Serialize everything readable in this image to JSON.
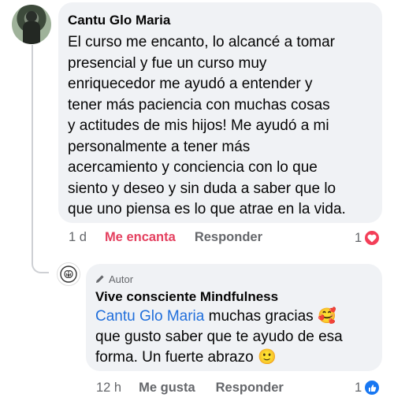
{
  "comment": {
    "author": "Cantu Glo Maria",
    "text": "El curso me encanto, lo alcancé a tomar\npresencial y fue un curso muy\nenriquecedor me ayudó a entender y\ntener más paciencia con muchas cosas\ny actitudes de mis hijos! Me ayudó a mi\npersonalmente a tener más\nacercamiento y conciencia con lo que\nsiento y deseo y sin duda a saber que lo\nque uno piensa es lo que atrae en la vida.",
    "time": "1 d",
    "reaction_label": "Me encanta",
    "reply_label": "Responder",
    "reaction_count": "1",
    "reaction_icon": "heart-icon"
  },
  "reply": {
    "badge_label": "Autor",
    "author": "Vive consciente Mindfulness",
    "mention": "Cantu Glo Maria",
    "text_after_mention": " muchas gracias",
    "text_line2": "que gusto saber que te ayudo de esa",
    "text_line3": "forma. Un fuerte abrazo",
    "emoji1": "🥰",
    "emoji2": "🙂",
    "time": "12 h",
    "like_label": "Me gusta",
    "reply_label": "Responder",
    "reaction_count": "1",
    "reaction_icon": "thumbs-up-icon"
  },
  "colors": {
    "bubble_bg": "#f0f2f5",
    "love_red": "#e4405f",
    "mention_blue": "#216fdb",
    "meta_gray": "#65676b",
    "like_blue": "#1877f2"
  }
}
